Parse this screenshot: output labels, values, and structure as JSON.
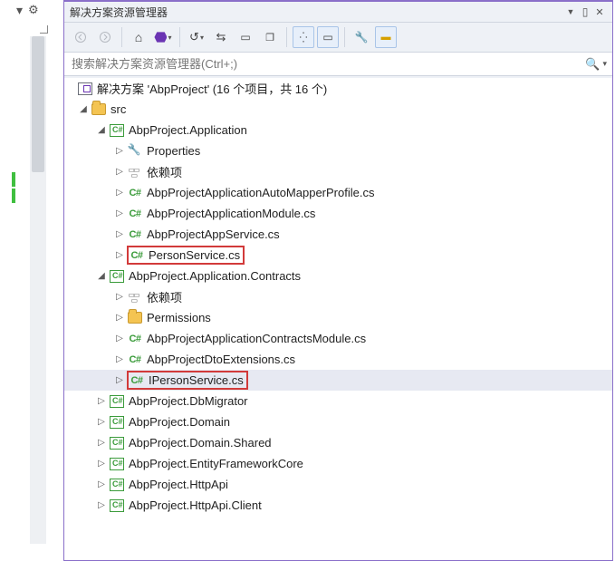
{
  "titleBar": {
    "title": "解决方案资源管理器"
  },
  "search": {
    "placeholder": "搜索解决方案资源管理器(Ctrl+;)"
  },
  "toolbar": {
    "back": "返回",
    "forward": "前进",
    "home": "主页",
    "switchViews": "切换视图",
    "history": "历史",
    "sync": "与活动文档同步",
    "refresh": "刷新",
    "collapse": "全部折叠",
    "showAll": "显示所有文件",
    "preview": "预览选定项",
    "properties": "属性"
  },
  "solutionLine": {
    "prefix": "解决方案 ",
    "name": "'AbpProject'",
    "suffix": " (16 个项目，共 16 个)"
  },
  "labels": {
    "src": "src",
    "app": "AbpProject.Application",
    "properties": "Properties",
    "deps": "依赖项",
    "autoMapper": "AbpProjectApplicationAutoMapperProfile.cs",
    "appModule": "AbpProjectApplicationModule.cs",
    "appService": "AbpProjectAppService.cs",
    "personService": "PersonService.cs",
    "contracts": "AbpProject.Application.Contracts",
    "permissions": "Permissions",
    "contractsModule": "AbpProjectApplicationContractsModule.cs",
    "dtoExt": "AbpProjectDtoExtensions.cs",
    "ipersonService": "IPersonService.cs",
    "dbMigrator": "AbpProject.DbMigrator",
    "domain": "AbpProject.Domain",
    "domainShared": "AbpProject.Domain.Shared",
    "efCore": "AbpProject.EntityFrameworkCore",
    "httpApi": "AbpProject.HttpApi",
    "httpApiClient": "AbpProject.HttpApi.Client"
  },
  "highlightedFiles": [
    "PersonService.cs",
    "IPersonService.cs"
  ],
  "selectedNode": "IPersonService.cs"
}
